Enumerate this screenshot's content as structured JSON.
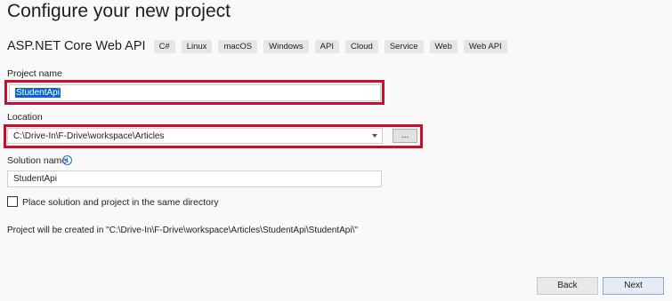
{
  "header": {
    "title": "Configure your new project",
    "template_name": "ASP.NET Core Web API",
    "tags": [
      "C#",
      "Linux",
      "macOS",
      "Windows",
      "API",
      "Cloud",
      "Service",
      "Web",
      "Web API"
    ]
  },
  "form": {
    "project_name": {
      "label": "Project name",
      "value": "StudentApi"
    },
    "location": {
      "label": "Location",
      "value": "C:\\Drive-In\\F-Drive\\workspace\\Articles",
      "browse_label": "..."
    },
    "solution_name": {
      "label": "Solution name",
      "value": "StudentApi",
      "info_icon": "info-icon"
    },
    "same_directory": {
      "label": "Place solution and project in the same directory",
      "checked": false
    },
    "creation_note": "Project will be created in \"C:\\Drive-In\\F-Drive\\workspace\\Articles\\StudentApi\\StudentApi\\\""
  },
  "footer": {
    "back_label": "Back",
    "next_label": "Next"
  },
  "colors": {
    "highlight": "#c8102e",
    "selection": "#0a64d2",
    "background": "#f9f9fa"
  }
}
